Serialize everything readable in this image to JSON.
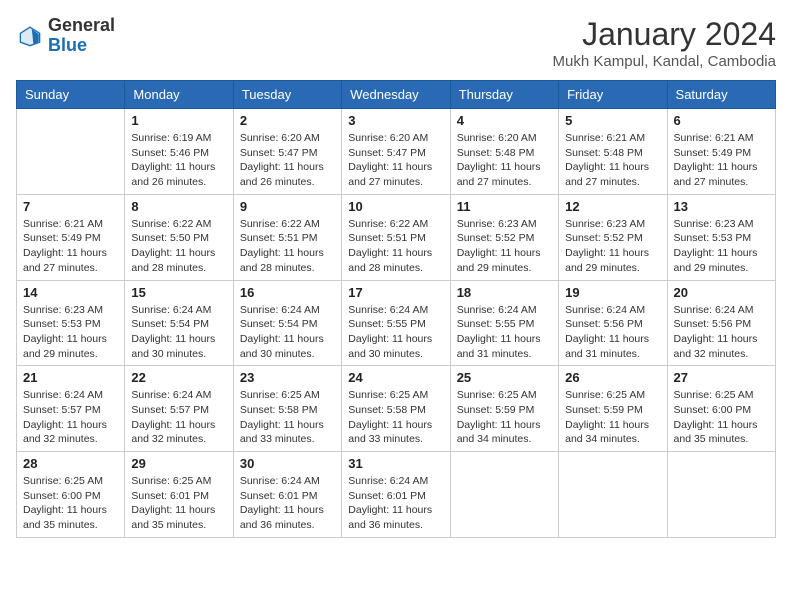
{
  "logo": {
    "general": "General",
    "blue": "Blue"
  },
  "title": "January 2024",
  "location": "Mukh Kampul, Kandal, Cambodia",
  "days_header": [
    "Sunday",
    "Monday",
    "Tuesday",
    "Wednesday",
    "Thursday",
    "Friday",
    "Saturday"
  ],
  "weeks": [
    [
      {
        "day": "",
        "info": ""
      },
      {
        "day": "1",
        "info": "Sunrise: 6:19 AM\nSunset: 5:46 PM\nDaylight: 11 hours\nand 26 minutes."
      },
      {
        "day": "2",
        "info": "Sunrise: 6:20 AM\nSunset: 5:47 PM\nDaylight: 11 hours\nand 26 minutes."
      },
      {
        "day": "3",
        "info": "Sunrise: 6:20 AM\nSunset: 5:47 PM\nDaylight: 11 hours\nand 27 minutes."
      },
      {
        "day": "4",
        "info": "Sunrise: 6:20 AM\nSunset: 5:48 PM\nDaylight: 11 hours\nand 27 minutes."
      },
      {
        "day": "5",
        "info": "Sunrise: 6:21 AM\nSunset: 5:48 PM\nDaylight: 11 hours\nand 27 minutes."
      },
      {
        "day": "6",
        "info": "Sunrise: 6:21 AM\nSunset: 5:49 PM\nDaylight: 11 hours\nand 27 minutes."
      }
    ],
    [
      {
        "day": "7",
        "info": "Sunrise: 6:21 AM\nSunset: 5:49 PM\nDaylight: 11 hours\nand 27 minutes."
      },
      {
        "day": "8",
        "info": "Sunrise: 6:22 AM\nSunset: 5:50 PM\nDaylight: 11 hours\nand 28 minutes."
      },
      {
        "day": "9",
        "info": "Sunrise: 6:22 AM\nSunset: 5:51 PM\nDaylight: 11 hours\nand 28 minutes."
      },
      {
        "day": "10",
        "info": "Sunrise: 6:22 AM\nSunset: 5:51 PM\nDaylight: 11 hours\nand 28 minutes."
      },
      {
        "day": "11",
        "info": "Sunrise: 6:23 AM\nSunset: 5:52 PM\nDaylight: 11 hours\nand 29 minutes."
      },
      {
        "day": "12",
        "info": "Sunrise: 6:23 AM\nSunset: 5:52 PM\nDaylight: 11 hours\nand 29 minutes."
      },
      {
        "day": "13",
        "info": "Sunrise: 6:23 AM\nSunset: 5:53 PM\nDaylight: 11 hours\nand 29 minutes."
      }
    ],
    [
      {
        "day": "14",
        "info": "Sunrise: 6:23 AM\nSunset: 5:53 PM\nDaylight: 11 hours\nand 29 minutes."
      },
      {
        "day": "15",
        "info": "Sunrise: 6:24 AM\nSunset: 5:54 PM\nDaylight: 11 hours\nand 30 minutes."
      },
      {
        "day": "16",
        "info": "Sunrise: 6:24 AM\nSunset: 5:54 PM\nDaylight: 11 hours\nand 30 minutes."
      },
      {
        "day": "17",
        "info": "Sunrise: 6:24 AM\nSunset: 5:55 PM\nDaylight: 11 hours\nand 30 minutes."
      },
      {
        "day": "18",
        "info": "Sunrise: 6:24 AM\nSunset: 5:55 PM\nDaylight: 11 hours\nand 31 minutes."
      },
      {
        "day": "19",
        "info": "Sunrise: 6:24 AM\nSunset: 5:56 PM\nDaylight: 11 hours\nand 31 minutes."
      },
      {
        "day": "20",
        "info": "Sunrise: 6:24 AM\nSunset: 5:56 PM\nDaylight: 11 hours\nand 32 minutes."
      }
    ],
    [
      {
        "day": "21",
        "info": "Sunrise: 6:24 AM\nSunset: 5:57 PM\nDaylight: 11 hours\nand 32 minutes."
      },
      {
        "day": "22",
        "info": "Sunrise: 6:24 AM\nSunset: 5:57 PM\nDaylight: 11 hours\nand 32 minutes."
      },
      {
        "day": "23",
        "info": "Sunrise: 6:25 AM\nSunset: 5:58 PM\nDaylight: 11 hours\nand 33 minutes."
      },
      {
        "day": "24",
        "info": "Sunrise: 6:25 AM\nSunset: 5:58 PM\nDaylight: 11 hours\nand 33 minutes."
      },
      {
        "day": "25",
        "info": "Sunrise: 6:25 AM\nSunset: 5:59 PM\nDaylight: 11 hours\nand 34 minutes."
      },
      {
        "day": "26",
        "info": "Sunrise: 6:25 AM\nSunset: 5:59 PM\nDaylight: 11 hours\nand 34 minutes."
      },
      {
        "day": "27",
        "info": "Sunrise: 6:25 AM\nSunset: 6:00 PM\nDaylight: 11 hours\nand 35 minutes."
      }
    ],
    [
      {
        "day": "28",
        "info": "Sunrise: 6:25 AM\nSunset: 6:00 PM\nDaylight: 11 hours\nand 35 minutes."
      },
      {
        "day": "29",
        "info": "Sunrise: 6:25 AM\nSunset: 6:01 PM\nDaylight: 11 hours\nand 35 minutes."
      },
      {
        "day": "30",
        "info": "Sunrise: 6:24 AM\nSunset: 6:01 PM\nDaylight: 11 hours\nand 36 minutes."
      },
      {
        "day": "31",
        "info": "Sunrise: 6:24 AM\nSunset: 6:01 PM\nDaylight: 11 hours\nand 36 minutes."
      },
      {
        "day": "",
        "info": ""
      },
      {
        "day": "",
        "info": ""
      },
      {
        "day": "",
        "info": ""
      }
    ]
  ]
}
